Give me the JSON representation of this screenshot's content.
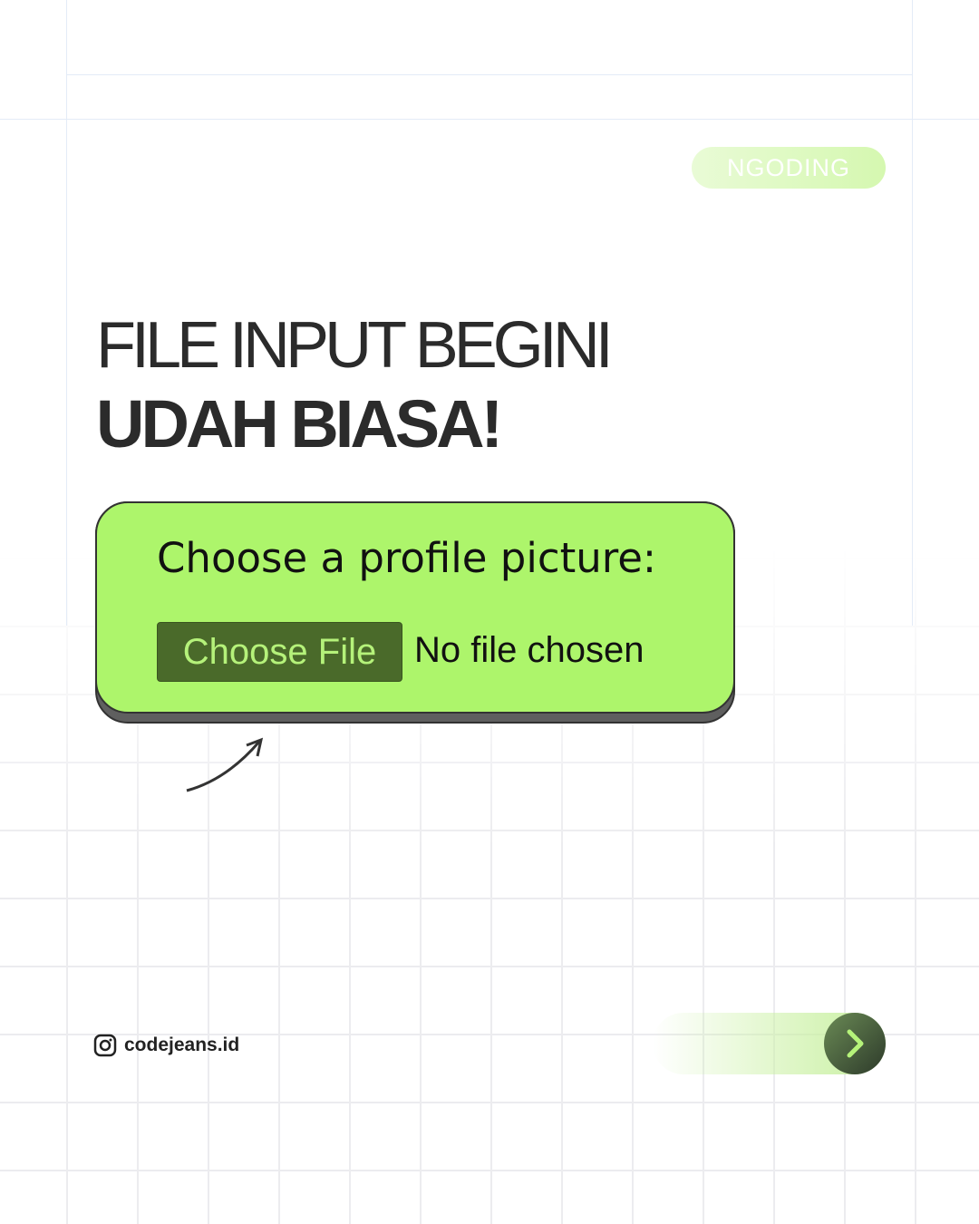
{
  "badge": "NGODING",
  "title": {
    "line1": "FILE INPUT BEGINI",
    "line2": "UDAH BIASA!"
  },
  "demo": {
    "label": "Choose a profile picture:",
    "button": "Choose File",
    "status": "No file chosen"
  },
  "footer": {
    "handle": "codejeans.id",
    "icon": "instagram-icon",
    "next_icon": "chevron-right-icon"
  },
  "colors": {
    "card": "#adf56b",
    "button": "#4a6a2a",
    "text": "#2b2b2b"
  }
}
